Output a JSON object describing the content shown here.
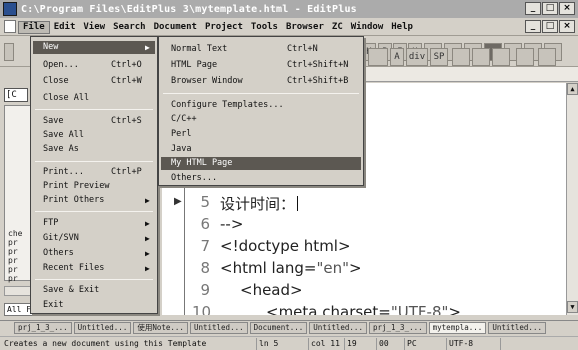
{
  "window": {
    "title": "C:\\Program Files\\EditPlus 3\\mytemplate.html - EditPlus",
    "buttons": [
      "_",
      "□",
      "×"
    ],
    "doc_buttons": [
      "_",
      "□",
      "×"
    ]
  },
  "menubar": {
    "items": [
      "File",
      "Edit",
      "View",
      "Search",
      "Document",
      "Project",
      "Tools",
      "Browser",
      "ZC",
      "Window",
      "Help"
    ]
  },
  "toolbar": {
    "labels": [
      "A",
      "A",
      "H",
      "B",
      "I",
      "U",
      "A",
      "div",
      "SP"
    ]
  },
  "ruler": {
    "text": "----2----+----3----+---"
  },
  "left_panel": {
    "directory": "[C",
    "files": [
      "che",
      "pr",
      "pr",
      "pr",
      "pr",
      "pr"
    ],
    "filter": "All Files (*.*)"
  },
  "file_menu": {
    "items": [
      {
        "label": "New",
        "shortcut": "",
        "submenu": true
      },
      {
        "label": "Open...",
        "shortcut": "Ctrl+O"
      },
      {
        "label": "Close",
        "shortcut": "Ctrl+W"
      },
      {
        "label": "Close All",
        "shortcut": ""
      },
      {
        "label": "Save",
        "shortcut": "Ctrl+S"
      },
      {
        "label": "Save All",
        "shortcut": ""
      },
      {
        "label": "Save As",
        "shortcut": ""
      },
      {
        "label": "Print...",
        "shortcut": "Ctrl+P"
      },
      {
        "label": "Print Preview",
        "shortcut": ""
      },
      {
        "label": "Print Others",
        "shortcut": "",
        "submenu": true
      },
      {
        "label": "FTP",
        "shortcut": "",
        "submenu": true
      },
      {
        "label": "Git/SVN",
        "shortcut": "",
        "submenu": true
      },
      {
        "label": "Others",
        "shortcut": "",
        "submenu": true
      },
      {
        "label": "Recent Files",
        "shortcut": "",
        "submenu": true
      },
      {
        "label": "Save & Exit",
        "shortcut": ""
      },
      {
        "label": "Exit",
        "shortcut": ""
      }
    ]
  },
  "new_submenu": {
    "items": [
      {
        "label": "Normal Text",
        "shortcut": "Ctrl+N"
      },
      {
        "label": "HTML Page",
        "shortcut": "Ctrl+Shift+N"
      },
      {
        "label": "Browser Window",
        "shortcut": "Ctrl+Shift+B"
      },
      {
        "label": "Configure Templates...",
        "shortcut": ""
      },
      {
        "label": "C/C++",
        "shortcut": ""
      },
      {
        "label": "Perl",
        "shortcut": ""
      },
      {
        "label": "Java",
        "shortcut": ""
      },
      {
        "label": "My HTML Page",
        "shortcut": ""
      },
      {
        "label": "Others...",
        "shortcut": ""
      }
    ]
  },
  "editor": {
    "lines": [
      {
        "num": "5",
        "text": "设计时间："
      },
      {
        "num": "6",
        "text": "-->"
      },
      {
        "num": "7",
        "text": "<!doctype html>"
      },
      {
        "num": "8",
        "prefix": "<html lang=",
        "str": "\"en\"",
        "suffix": ">"
      },
      {
        "num": "9",
        "text": "<head>"
      },
      {
        "num": "10",
        "prefix": "<meta charset=",
        "str": "\"UTF-8\"",
        "suffix": ">"
      }
    ]
  },
  "tabs": [
    "prj_1_3_...",
    "Untitled...",
    "使用Note...",
    "Untitled...",
    "Document...",
    "Untitled...",
    "prj_1_3_...",
    "mytempla...",
    "Untitled..."
  ],
  "statusbar": {
    "message": "Creates a new document using this Template",
    "line": "ln 5",
    "col": "col 11",
    "num1": "19",
    "num2": "00",
    "mode": "PC",
    "encoding": "UTF-8"
  }
}
